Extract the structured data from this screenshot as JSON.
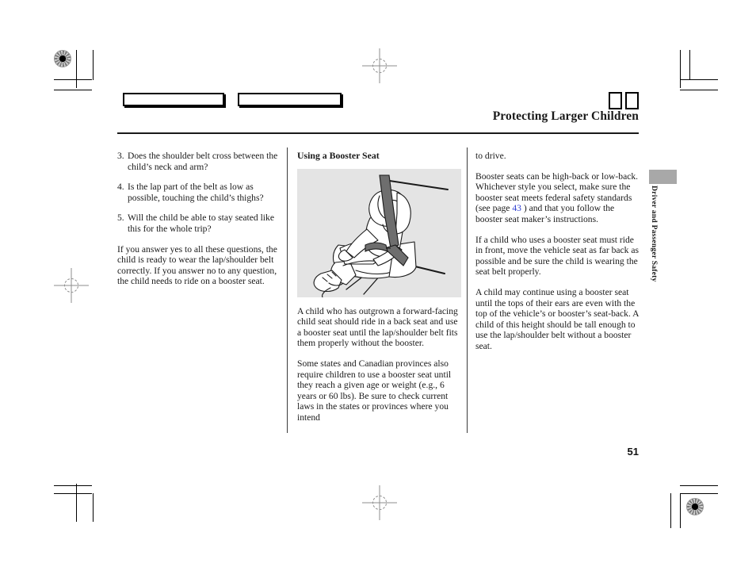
{
  "document": {
    "header_title": "Protecting Larger Children",
    "page_number": "51",
    "side_tab_label": "Driver and Passenger Safety"
  },
  "columns": {
    "left": {
      "questions": [
        {
          "number": "3.",
          "text": "Does the shoulder belt cross between the child’s neck and arm?"
        },
        {
          "number": "4.",
          "text": "Is the lap part of the belt as low as possible, touching the child’s thighs?"
        },
        {
          "number": "5.",
          "text": "Will the child be able to stay seated like this for the whole trip?"
        }
      ],
      "closing_paragraph": "If you answer yes to all these questions, the child is ready to wear the lap/shoulder belt correctly. If you answer no to any question, the child needs to ride on a booster seat."
    },
    "middle": {
      "heading": "Using a Booster Seat",
      "figure_caption": "child seated on booster seat wearing lap/shoulder belt",
      "paragraphs": [
        "A child who has outgrown a forward-facing child seat should ride in a back seat and use a booster seat until the lap/shoulder belt fits them properly without the booster.",
        "Some states and Canadian provinces also require children to use a booster seat until they reach a given age or weight (e.g., 6 years or 60 lbs). Be sure to check current laws in the states or provinces where you intend"
      ]
    },
    "right": {
      "continued_text": "to drive.",
      "paragraph_2_before_xref": "Booster seats can be high-back or low-back. Whichever style you select, make sure the booster seat meets federal safety standards (see page",
      "cross_reference_page": "43",
      "paragraph_2_after_xref": ") and that you follow the booster seat maker’s instructions.",
      "paragraph_3": "If a child who uses a booster seat must ride in front, move the vehicle seat as far back as possible and be sure the child is wearing the seat belt properly.",
      "paragraph_4": "A child may continue using a booster seat until the tops of their ears are even with the top of the vehicle’s or booster’s seat-back. A child of this height should be tall enough to use the lap/shoulder belt without a booster seat."
    }
  },
  "print_marks": {
    "registration_target": "registration-target",
    "crosshair": "crosshair-mark",
    "crop_mark": "crop-mark"
  },
  "colors": {
    "xref_blue": "#2e3ed0",
    "tab_gray": "#a8a8a8",
    "figure_bg": "#e4e4e4",
    "ink": "#1a1a1a"
  }
}
